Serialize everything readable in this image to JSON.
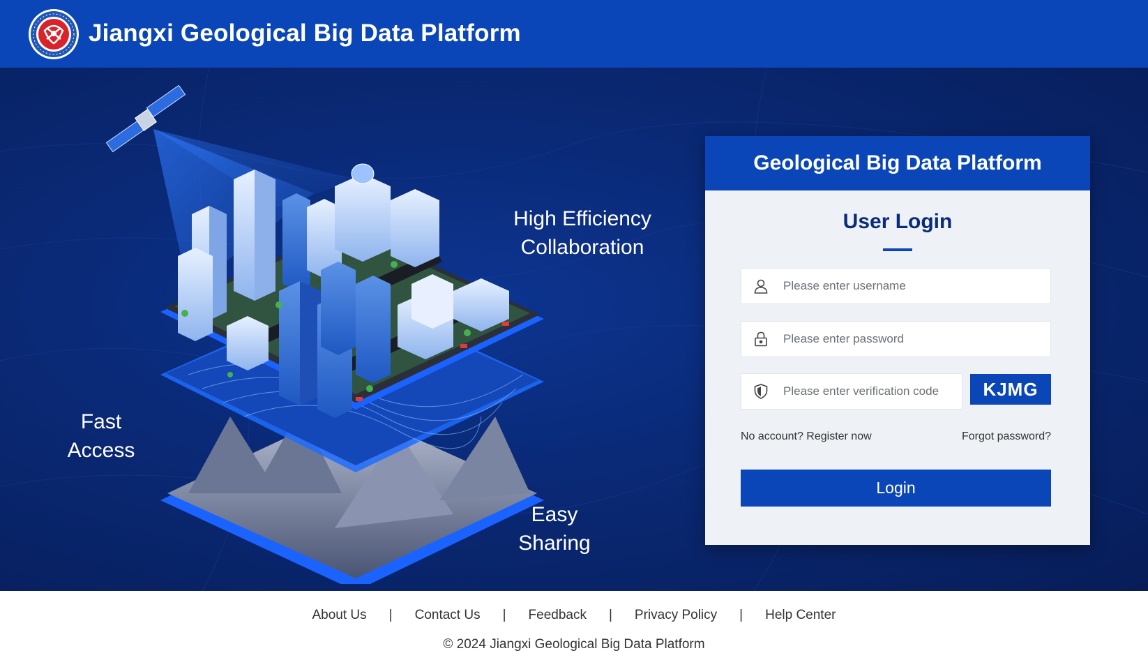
{
  "header": {
    "site_title": "Jiangxi Geological Big Data Platform",
    "logo_icon": "geological-bureau-emblem-icon"
  },
  "hero": {
    "slogans": {
      "collaboration_line1": "High Efficiency",
      "collaboration_line2": "Collaboration",
      "fast_line1": "Fast",
      "fast_line2": "Access",
      "share_line1": "Easy",
      "share_line2": "Sharing"
    }
  },
  "login": {
    "card_title": "Geological Big Data Platform",
    "heading": "User Login",
    "username_placeholder": "Please enter username",
    "password_placeholder": "Please enter password",
    "captcha_placeholder": "Please enter verification code",
    "captcha_code": "KJMG",
    "register_link": "No account? Register now",
    "forgot_link": "Forgot password?",
    "submit_label": "Login",
    "icons": {
      "username": "user-icon",
      "password": "lock-icon",
      "captcha": "shield-icon"
    }
  },
  "footer": {
    "links": [
      "About Us",
      "Contact Us",
      "Feedback",
      "Privacy Policy",
      "Help Center"
    ],
    "separator": "|",
    "copyright": "© 2024 Jiangxi Geological Big Data Platform"
  },
  "colors": {
    "brand_blue": "#0a46b8",
    "hero_dark": "#071d58",
    "card_bg": "#eef1f6",
    "heading_navy": "#0a2c7a"
  }
}
